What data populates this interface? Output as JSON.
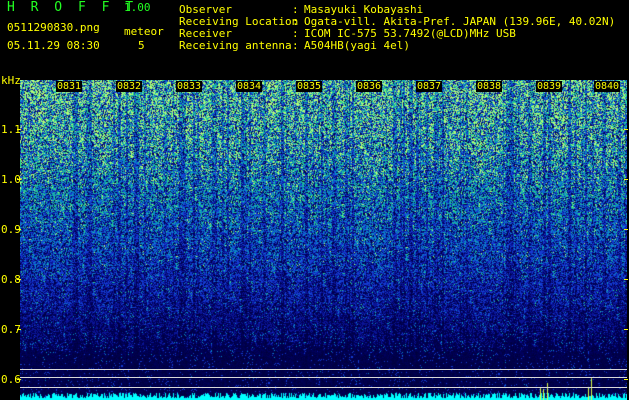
{
  "app": {
    "title": "H R O F F T",
    "version": "1.00"
  },
  "file": {
    "name": "0511290830.png",
    "datetime": "05.11.29 08:30"
  },
  "meteor": {
    "label": "meteor",
    "count": "5"
  },
  "info": [
    {
      "label": "Observer",
      "value": "Masayuki Kobayashi"
    },
    {
      "label": "Receiving Location",
      "value": "Ogata-vill. Akita-Pref. JAPAN (139.96E, 40.02N)"
    },
    {
      "label": "Receiver",
      "value": "ICOM IC-575 53.7492(@LCD)MHz USB"
    },
    {
      "label": "Receiving antenna",
      "value": "A504HB(yagi 4el)"
    }
  ],
  "info_separator": ":",
  "y_axis": {
    "unit": "kHz",
    "ticks": [
      "1.1",
      "1.0",
      "0.9",
      "0.8",
      "0.7",
      "0.6"
    ]
  },
  "time_ticks": [
    "0831",
    "0832",
    "0833",
    "0834",
    "0835",
    "0836",
    "0837",
    "0838",
    "0839",
    "0840"
  ],
  "colors": {
    "text": "#ffff00",
    "accent": "#22ff22",
    "background": "#000000"
  }
}
